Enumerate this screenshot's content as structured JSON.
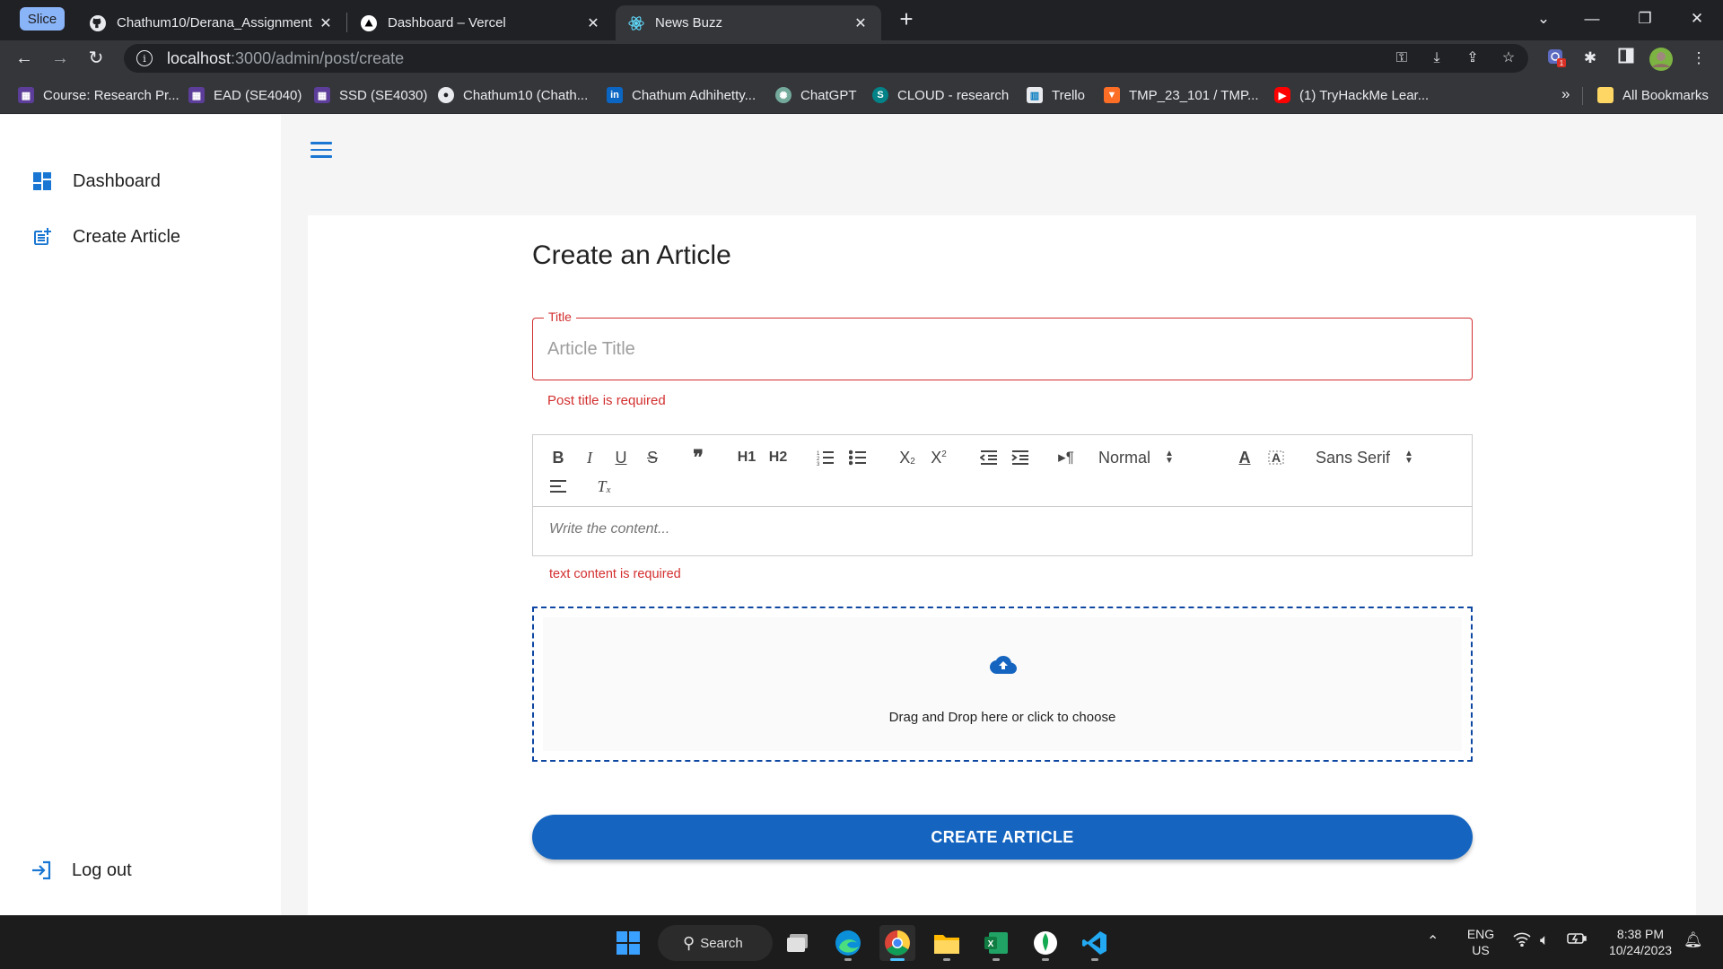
{
  "browser": {
    "slice_label": "Slice",
    "tabs": [
      {
        "label": "Chathum10/Derana_Assignment",
        "close": "✕"
      },
      {
        "label": "Dashboard – Vercel",
        "close": "✕"
      },
      {
        "label": "News Buzz",
        "close": "✕"
      }
    ],
    "new_tab": "+",
    "url_host": "localhost",
    "url_path": ":3000/admin/post/create",
    "bookmarks": [
      {
        "label": "Course: Research Pr..."
      },
      {
        "label": "EAD (SE4040)"
      },
      {
        "label": "SSD (SE4030)"
      },
      {
        "label": "Chathum10 (Chath..."
      },
      {
        "label": "Chathum Adhihetty..."
      },
      {
        "label": "ChatGPT"
      },
      {
        "label": "CLOUD - research"
      },
      {
        "label": "Trello"
      },
      {
        "label": "TMP_23_101 / TMP..."
      },
      {
        "label": "(1) TryHackMe Lear..."
      }
    ],
    "bookmarks_more": "»",
    "all_bookmarks": "All Bookmarks",
    "extension_badge": "1"
  },
  "sidebar": {
    "items": [
      {
        "label": "Dashboard",
        "icon": "dashboard-icon"
      },
      {
        "label": "Create Article",
        "icon": "post-add-icon"
      }
    ],
    "logout": {
      "label": "Log out",
      "icon": "logout-icon"
    }
  },
  "form": {
    "heading": "Create an Article",
    "title_field": {
      "label": "Title",
      "placeholder": "Article Title",
      "value": "",
      "error": "Post title is required"
    },
    "editor": {
      "header_picker": "Normal",
      "font_picker": "Sans Serif",
      "placeholder": "Write the content...",
      "error": "text content is required",
      "toolbar_buttons": [
        "bold",
        "italic",
        "underline",
        "strike",
        "blockquote",
        "header-1",
        "header-2",
        "ordered-list",
        "bullet-list",
        "subscript",
        "superscript",
        "outdent",
        "indent",
        "direction",
        "color",
        "background",
        "align",
        "clean"
      ],
      "labels": {
        "h1": "H1",
        "h2": "H2",
        "x": "X",
        "sub": "2",
        "sup": "2",
        "b": "B",
        "i": "I",
        "u": "U",
        "s": "S",
        "quote": "❞",
        "pilcrow": "¶",
        "color_a": "A",
        "clean": "T"
      }
    },
    "dropzone": {
      "text": "Drag and Drop here or click to choose",
      "icon": "cloud-upload-icon"
    },
    "submit_label": "CREATE ARTICLE"
  },
  "taskbar": {
    "search_label": "Search",
    "language": "ENG",
    "region": "US",
    "time": "8:38 PM",
    "date": "10/24/2023"
  },
  "colors": {
    "primary": "#1976d2",
    "button": "#1565c0",
    "error": "#d32f2f",
    "dropzone_border": "#0d47a1"
  }
}
